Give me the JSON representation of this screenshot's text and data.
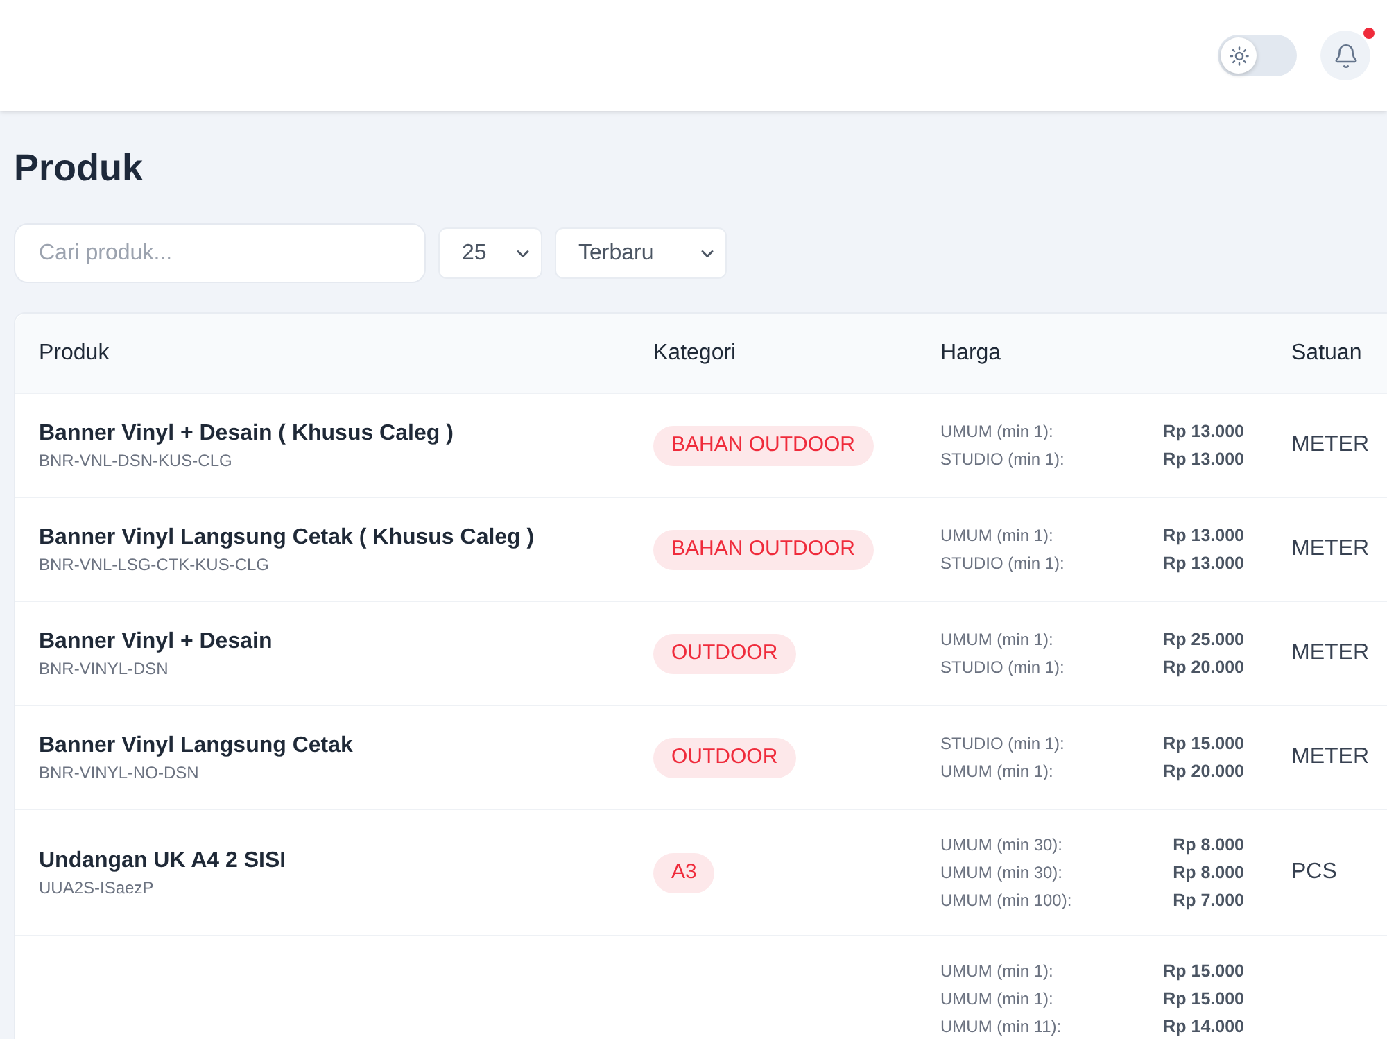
{
  "header": {
    "theme_toggle": {
      "on": false
    },
    "notifications": {
      "has_unread": true
    }
  },
  "page_title": "Produk",
  "filters": {
    "search": {
      "placeholder": "Cari produk..."
    },
    "per_page": {
      "value": "25"
    },
    "sort": {
      "value": "Terbaru"
    }
  },
  "table": {
    "columns": [
      "Produk",
      "Kategori",
      "Harga",
      "Satuan"
    ],
    "rows": [
      {
        "name": "Banner Vinyl + Desain ( Khusus Caleg )",
        "code": "BNR-VNL-DSN-KUS-CLG",
        "category": "BAHAN OUTDOOR",
        "prices": [
          {
            "label": "UMUM (min 1):",
            "price": "Rp 13.000"
          },
          {
            "label": "STUDIO (min 1):",
            "price": "Rp 13.000"
          }
        ],
        "unit": "METER"
      },
      {
        "name": "Banner Vinyl Langsung Cetak ( Khusus Caleg )",
        "code": "BNR-VNL-LSG-CTK-KUS-CLG",
        "category": "BAHAN OUTDOOR",
        "prices": [
          {
            "label": "UMUM (min 1):",
            "price": "Rp 13.000"
          },
          {
            "label": "STUDIO (min 1):",
            "price": "Rp 13.000"
          }
        ],
        "unit": "METER"
      },
      {
        "name": "Banner Vinyl + Desain",
        "code": "BNR-VINYL-DSN",
        "category": "OUTDOOR",
        "prices": [
          {
            "label": "UMUM (min 1):",
            "price": "Rp 25.000"
          },
          {
            "label": "STUDIO (min 1):",
            "price": "Rp 20.000"
          }
        ],
        "unit": "METER"
      },
      {
        "name": "Banner Vinyl Langsung Cetak",
        "code": "BNR-VINYL-NO-DSN",
        "category": "OUTDOOR",
        "prices": [
          {
            "label": "STUDIO (min 1):",
            "price": "Rp 15.000"
          },
          {
            "label": "UMUM (min 1):",
            "price": "Rp 20.000"
          }
        ],
        "unit": "METER"
      },
      {
        "name": "Undangan UK A4 2 SISI",
        "code": "UUA2S-ISaezP",
        "category": "A3",
        "prices": [
          {
            "label": "UMUM (min 30):",
            "price": "Rp 8.000"
          },
          {
            "label": "UMUM (min 30):",
            "price": "Rp 8.000"
          },
          {
            "label": "UMUM (min 100):",
            "price": "Rp 7.000"
          }
        ],
        "unit": "PCS"
      },
      {
        "prices": [
          {
            "label": "UMUM (min 1):",
            "price": "Rp 15.000"
          },
          {
            "label": "UMUM (min 1):",
            "price": "Rp 15.000"
          },
          {
            "label": "UMUM (min 11):",
            "price": "Rp 14.000"
          }
        ]
      }
    ]
  }
}
